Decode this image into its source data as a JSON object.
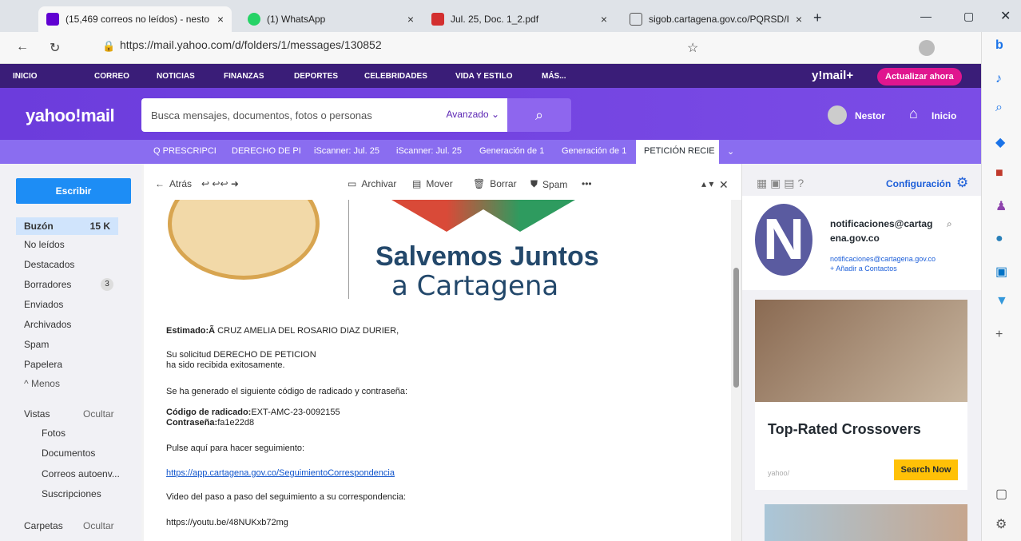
{
  "browser": {
    "tabs": [
      {
        "label": "(15,469 correos no leídos) - nesto",
        "active": true
      },
      {
        "label": "(1) WhatsApp",
        "active": false
      },
      {
        "label": "Jul. 25, Doc. 1_2.pdf",
        "active": false
      },
      {
        "label": "sigob.cartagena.gov.co/PQRSD/I",
        "active": false
      }
    ],
    "url": "https://mail.yahoo.com/d/folders/1/messages/130852"
  },
  "nav": {
    "items": [
      "INICIO",
      "CORREO",
      "NOTICIAS",
      "FINANZAS",
      "DEPORTES",
      "CELEBRIDADES",
      "VIDA Y ESTILO",
      "MÁS..."
    ],
    "brand": "y!mail+",
    "upgrade": "Actualizar ahora"
  },
  "header": {
    "logo": "yahoo!mail",
    "search_placeholder": "Busca mensajes, documentos, fotos o personas",
    "advanced": "Avanzado",
    "user": "Nestor",
    "home": "Inicio"
  },
  "message_tabs": [
    "Q PRESCRIPCI",
    "DERECHO DE PI",
    "iScanner: Jul. 25",
    "iScanner: Jul. 25",
    "Generación de 1",
    "Generación de 1",
    "PETICIÓN RECIE"
  ],
  "sidebar": {
    "compose": "Escribir",
    "inbox": "Buzón",
    "inbox_count": "15 K",
    "folders": [
      "No leídos",
      "Destacados",
      "Borradores",
      "Enviados",
      "Archivados",
      "Spam",
      "Papelera"
    ],
    "drafts_count": "3",
    "less": "^ Menos",
    "views_label": "Vistas",
    "views_hide": "Ocultar",
    "views": [
      "Fotos",
      "Documentos",
      "Correos autoenv...",
      "Suscripciones"
    ],
    "folders_label": "Carpetas",
    "folders_hide": "Ocultar"
  },
  "toolbar": {
    "back": "Atrás",
    "archive": "Archivar",
    "move": "Mover",
    "delete": "Borrar",
    "spam": "Spam",
    "more": "•••"
  },
  "email": {
    "slogan1": "Salvemos Juntos",
    "slogan2": "a Cartagena",
    "greeting_label": "Estimado:Ã",
    "greeting_name": " CRUZ AMELIA DEL ROSARIO DIAZ DURIER,",
    "line1": "Su solicitud DERECHO DE PETICION",
    "line2": "ha sido recibida exitosamente.",
    "line3": "Se ha generado el siguiente código de radicado y contraseña:",
    "code_label": "Código de radicado:",
    "code_value": "EXT-AMC-23-0092155",
    "pass_label": "Contraseña:",
    "pass_value": "fa1e22d8",
    "line4": "Pulse aquí para hacer seguimiento:",
    "link1": "https://app.cartagena.gov.co/SeguimientoCorrespondencia",
    "line5": "Video del paso a paso del seguimiento a su correspondencia:",
    "link2": "https://youtu.be/48NUKxb72mg"
  },
  "rail": {
    "settings": "Configuración",
    "sender_name_1": "notificaciones@cartag",
    "sender_name_2": "ena.gov.co",
    "sender_email": "notificaciones@cartagena.gov.co",
    "add_contact": "+ Añadir a Contactos",
    "avatar_letter": "N",
    "ad_title": "Top-Rated Crossovers",
    "ad_brand": "yahoo/",
    "ad_cta": "Search Now"
  }
}
